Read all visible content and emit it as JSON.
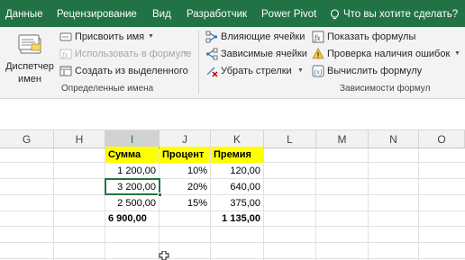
{
  "ribbon_tabs": [
    "Данные",
    "Рецензирование",
    "Вид",
    "Разработчик",
    "Power Pivot"
  ],
  "tell_me": "Что вы хотите сделать?",
  "colors": {
    "ribbon_green": "#217346",
    "header_fill": "#ffff00"
  },
  "groups": {
    "names": {
      "name_manager_line1": "Диспетчер",
      "name_manager_line2": "имен",
      "assign_name": "Присвоить имя",
      "use_in_formula": "Использовать в формуле",
      "create_from_selection": "Создать из выделенного",
      "label": "Определенные имена"
    },
    "audit": {
      "trace_precedents": "Влияющие ячейки",
      "trace_dependents": "Зависимые ячейки",
      "remove_arrows": "Убрать стрелки",
      "show_formulas": "Показать формулы",
      "error_checking": "Проверка наличия ошибок",
      "evaluate_formula": "Вычислить формулу",
      "label": "Зависимости формул"
    }
  },
  "columns": [
    "G",
    "H",
    "I",
    "J",
    "K",
    "L",
    "M",
    "N",
    "O"
  ],
  "selected_column": "I",
  "table": {
    "headers": [
      "Сумма",
      "Процент",
      "Премия"
    ],
    "rows": [
      [
        "1 200,00",
        "10%",
        "120,00"
      ],
      [
        "3 200,00",
        "20%",
        "640,00"
      ],
      [
        "2 500,00",
        "15%",
        "375,00"
      ]
    ],
    "totals": [
      "6 900,00",
      "",
      "1 135,00"
    ]
  }
}
